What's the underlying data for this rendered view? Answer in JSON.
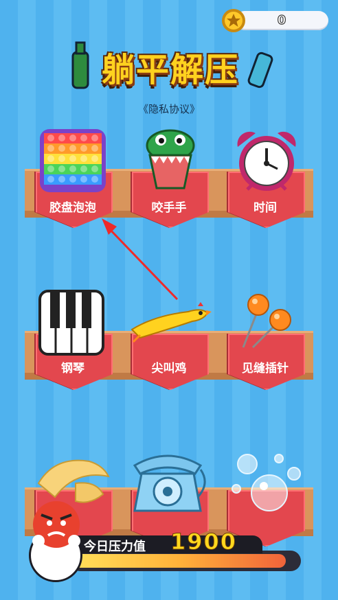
{
  "coins": {
    "value": "0"
  },
  "title": {
    "text": "躺平解压",
    "privacy_link": "《隐私协议》"
  },
  "games": [
    {
      "label": "胶盘泡泡",
      "icon": "pop-it-icon"
    },
    {
      "label": "咬手手",
      "icon": "crocodile-icon"
    },
    {
      "label": "时间",
      "icon": "alarm-clock-icon"
    },
    {
      "label": "钢琴",
      "icon": "piano-icon"
    },
    {
      "label": "尖叫鸡",
      "icon": "rubber-chicken-icon"
    },
    {
      "label": "见缝插针",
      "icon": "pins-icon"
    },
    {
      "label": "",
      "icon": "egg-shell-icon"
    },
    {
      "label": "",
      "icon": "telephone-icon"
    },
    {
      "label": "",
      "icon": "bubbles-icon"
    }
  ],
  "pressure": {
    "label": "今日压力值",
    "value": "1900",
    "level": 0.95
  },
  "colors": {
    "card": "#e3474e",
    "shelf": "#d9955c",
    "background": "#4fb2ee",
    "accent": "#ffd81e"
  }
}
